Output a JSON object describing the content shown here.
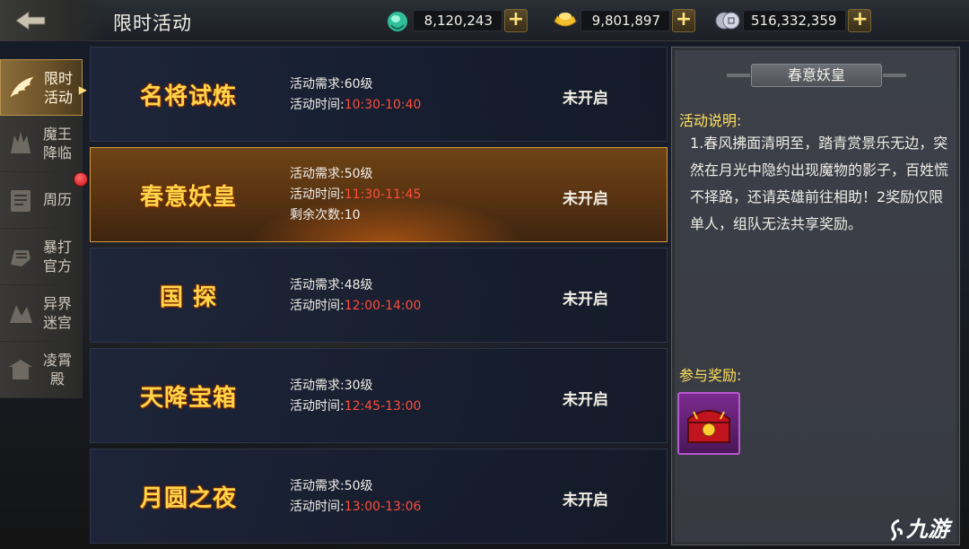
{
  "header": {
    "title": "限时活动",
    "currencies": [
      {
        "icon": "jade-icon",
        "value": "8,120,243"
      },
      {
        "icon": "gold-ingot-icon",
        "value": "9,801,897"
      },
      {
        "icon": "silver-coins-icon",
        "value": "516,332,359"
      }
    ],
    "plus_label": "+"
  },
  "sidebar": {
    "items": [
      {
        "label": "限时活动",
        "icon": "wing-icon",
        "active": true
      },
      {
        "label": "魔王降临",
        "icon": "demon-icon"
      },
      {
        "label": "周历",
        "icon": "scroll-icon"
      },
      {
        "label": "暴打官方",
        "icon": "fist-icon"
      },
      {
        "label": "异界迷宫",
        "icon": "maze-icon"
      },
      {
        "label": "凌霄殿",
        "icon": "palace-icon"
      }
    ]
  },
  "events": [
    {
      "name": "名将试炼",
      "requirement": "活动需求:60级",
      "time_label": "活动时间:",
      "time": "10:30-10:40",
      "status": "未开启"
    },
    {
      "name": "春意妖皇",
      "requirement": "活动需求:50级",
      "time_label": "活动时间:",
      "time": "11:30-11:45",
      "remaining": "剩余次数:10",
      "status": "未开启",
      "selected": true
    },
    {
      "name": "国 探",
      "requirement": "活动需求:48级",
      "time_label": "活动时间:",
      "time": "12:00-14:00",
      "status": "未开启"
    },
    {
      "name": "天降宝箱",
      "requirement": "活动需求:30级",
      "time_label": "活动时间:",
      "time": "12:45-13:00",
      "status": "未开启"
    },
    {
      "name": "月圆之夜",
      "requirement": "活动需求:50级",
      "time_label": "活动时间:",
      "time": "13:00-13:06",
      "status": "未开启"
    }
  ],
  "detail": {
    "title": "春意妖皇",
    "desc_heading": "活动说明:",
    "desc_text": "1.春风拂面清明至，踏青赏景乐无边，突然在月光中隐约出现魔物的影子，百姓慌不择路，还请英雄前往相助！2奖励仅限单人，组队无法共享奖励。",
    "reward_heading": "参与奖励:",
    "reward_icon": "red-treasure-chest-icon"
  },
  "watermark": "九游",
  "colors": {
    "accent_gold": "#ffd64a",
    "time_red": "#ff4d3a",
    "reward_purple": "#7a2a8e",
    "selected_border": "#d59a3a"
  }
}
